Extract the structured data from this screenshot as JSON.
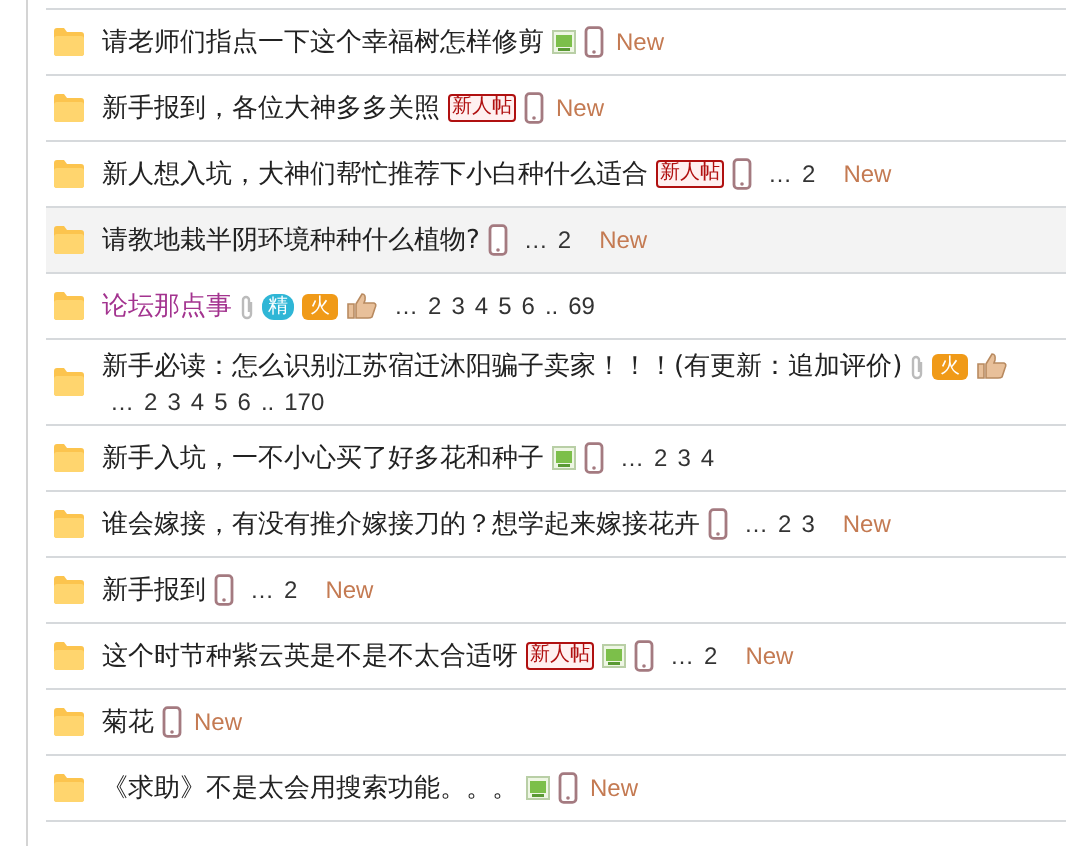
{
  "threads": [
    {
      "title": "请老师们指点一下这个幸福树怎样修剪",
      "highlighted": false,
      "markers": [
        {
          "kind": "image"
        },
        {
          "kind": "mobile"
        },
        {
          "kind": "new",
          "text": "New"
        }
      ]
    },
    {
      "title": "新手报到，各位大神多多关照",
      "highlighted": false,
      "markers": [
        {
          "kind": "tag",
          "text": "新人帖"
        },
        {
          "kind": "mobile"
        },
        {
          "kind": "new",
          "text": "New"
        }
      ]
    },
    {
      "title": "新人想入坑，大神们帮忙推荐下小白种什么适合",
      "highlighted": false,
      "markers": [
        {
          "kind": "tag",
          "text": "新人帖"
        },
        {
          "kind": "mobile"
        }
      ],
      "pages": [
        "…",
        "2"
      ],
      "after": [
        {
          "kind": "new",
          "text": "New"
        }
      ]
    },
    {
      "title": "请教地栽半阴环境种种什么植物?",
      "highlighted": true,
      "markers": [
        {
          "kind": "mobile"
        }
      ],
      "pages": [
        "…",
        "2"
      ],
      "after": [
        {
          "kind": "new",
          "text": "New"
        }
      ]
    },
    {
      "title": "论坛那点事",
      "color": "#a3338f",
      "highlighted": false,
      "markers": [
        {
          "kind": "attachment"
        },
        {
          "kind": "digest",
          "text": "精"
        },
        {
          "kind": "hot",
          "text": "火"
        },
        {
          "kind": "thumb"
        }
      ],
      "pages": [
        "…",
        "2",
        "3",
        "4",
        "5",
        "6",
        "..",
        "69"
      ]
    },
    {
      "title": "新手必读：怎么识别江苏宿迁沐阳骗子卖家！！！(有更新：追加评价)",
      "highlighted": false,
      "markers": [
        {
          "kind": "attachment"
        },
        {
          "kind": "hot",
          "text": "火"
        },
        {
          "kind": "thumb"
        }
      ],
      "pages": [
        "…",
        "2",
        "3",
        "4",
        "5",
        "6",
        "..",
        "170"
      ]
    },
    {
      "title": "新手入坑，一不小心买了好多花和种子",
      "highlighted": false,
      "markers": [
        {
          "kind": "image"
        },
        {
          "kind": "mobile"
        }
      ],
      "pages": [
        "…",
        "2",
        "3",
        "4"
      ]
    },
    {
      "title": "谁会嫁接，有没有推介嫁接刀的？想学起来嫁接花卉",
      "highlighted": false,
      "markers": [
        {
          "kind": "mobile"
        }
      ],
      "pages": [
        "…",
        "2",
        "3"
      ],
      "after": [
        {
          "kind": "new",
          "text": "New"
        }
      ]
    },
    {
      "title": "新手报到",
      "highlighted": false,
      "markers": [
        {
          "kind": "mobile"
        }
      ],
      "pages": [
        "…",
        "2"
      ],
      "after": [
        {
          "kind": "new",
          "text": "New"
        }
      ]
    },
    {
      "title": "这个时节种紫云英是不是不太合适呀",
      "highlighted": false,
      "markers": [
        {
          "kind": "tag",
          "text": "新人帖"
        },
        {
          "kind": "image"
        },
        {
          "kind": "mobile"
        }
      ],
      "pages": [
        "…",
        "2"
      ],
      "after": [
        {
          "kind": "new",
          "text": "New"
        }
      ]
    },
    {
      "title": "菊花",
      "highlighted": false,
      "markers": [
        {
          "kind": "mobile"
        },
        {
          "kind": "new",
          "text": "New"
        }
      ]
    },
    {
      "title": "《求助》不是太会用搜索功能。。。",
      "highlighted": false,
      "markers": [
        {
          "kind": "image"
        },
        {
          "kind": "mobile"
        },
        {
          "kind": "new",
          "text": "New"
        }
      ]
    }
  ]
}
